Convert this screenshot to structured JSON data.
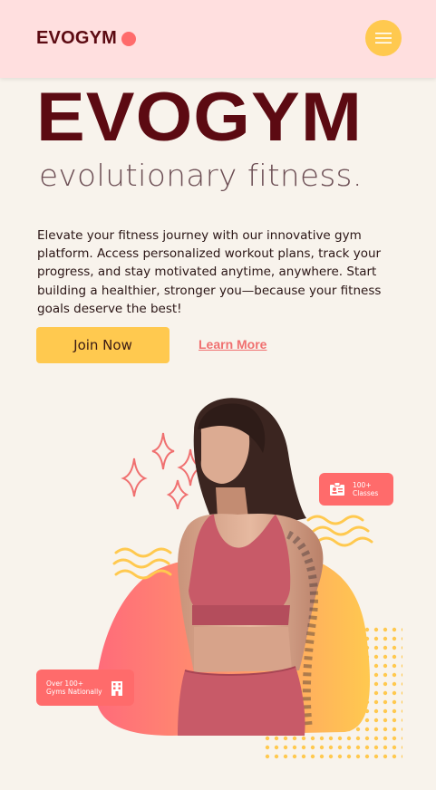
{
  "navbar": {
    "logo_text": "EVOGYM",
    "menu_icon": "hamburger-menu-icon"
  },
  "hero": {
    "title": "EVOGYM",
    "subtitle": "evolutionary fitness.",
    "description": "Elevate your fitness journey with our innovative gym platform. Access personalized workout plans, track your progress, and stay motivated anytime, anywhere. Start building a healthier, stronger you—because your fitness goals deserve the best!",
    "primary_button": "Join Now",
    "secondary_link": "Learn More"
  },
  "badges": {
    "classes": {
      "line1": "100+",
      "line2": "Classes",
      "icon": "id-card-icon"
    },
    "gyms": {
      "line1": "Over 100+",
      "line2": "Gyms Nationally",
      "icon": "building-icon"
    }
  },
  "colors": {
    "background": "#f8f3ec",
    "navbar": "#ffdfdf",
    "brand_dark": "#5c0a12",
    "accent_yellow": "#ffc94f",
    "accent_coral": "#ff6b6b"
  }
}
